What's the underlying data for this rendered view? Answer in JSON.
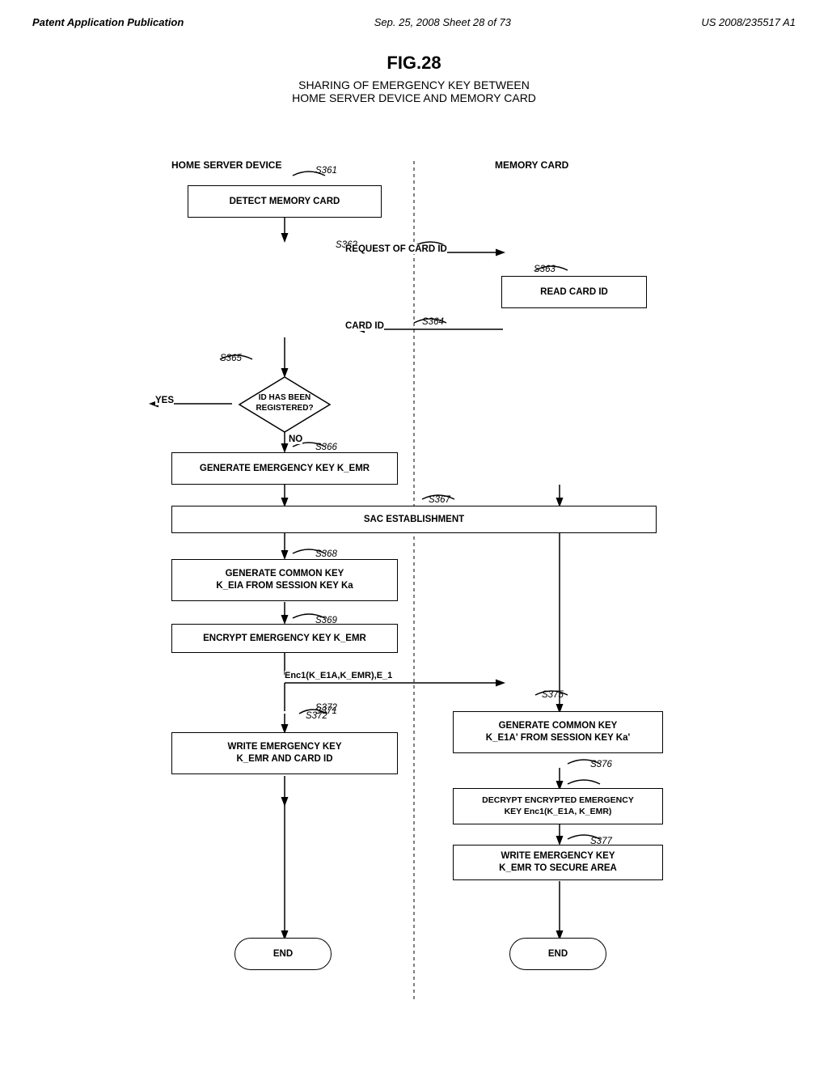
{
  "header": {
    "left": "Patent Application Publication",
    "center": "Sep. 25, 2008  Sheet 28 of 73",
    "right": "US 2008/235517 A1"
  },
  "fig": {
    "title": "FIG.28",
    "subtitle_line1": "SHARING OF EMERGENCY KEY BETWEEN",
    "subtitle_line2": "HOME SERVER DEVICE AND MEMORY CARD"
  },
  "columns": {
    "left": "HOME SERVER DEVICE",
    "right": "MEMORY CARD"
  },
  "steps": {
    "s361": "S361",
    "s362": "S362",
    "s363": "S363",
    "s364": "S364",
    "s365": "S365",
    "s366": "S366",
    "s367": "S367",
    "s368": "S368",
    "s369": "S369",
    "s371": "S371",
    "s372": "S372",
    "s375": "S375",
    "s376": "S376",
    "s377": "S377"
  },
  "boxes": {
    "detect_memory_card": "DETECT MEMORY CARD",
    "request_card_id": "REQUEST OF CARD ID",
    "read_card_id": "READ CARD ID",
    "card_id": "CARD ID",
    "id_registered": "ID HAS BEEN\nREGISTERED?",
    "yes": "YES",
    "no": "NO",
    "generate_emergency_key": "GENERATE EMERGENCY KEY K_EMR",
    "sac_establishment": "SAC ESTABLISHMENT",
    "generate_common_key": "GENERATE COMMON KEY\nK_EIA FROM SESSION KEY Ka",
    "encrypt_emergency_key": "ENCRYPT EMERGENCY KEY K_EMR",
    "enc1_label": "Enc1(K_E1A,K_EMR),E_1",
    "generate_common_key2": "GENERATE COMMON KEY\nK_E1A' FROM SESSION KEY Ka'",
    "write_emergency_key": "WRITE EMERGENCY KEY\nK_EMR AND CARD ID",
    "decrypt_encrypted": "DECRYPT ENCRYPTED EMERGENCY\nKEY Enc1(K_E1A, K_EMR)",
    "write_emergency_key2": "WRITE EMERGENCY KEY\nK_EMR TO SECURE AREA",
    "end1": "END",
    "end2": "END"
  }
}
